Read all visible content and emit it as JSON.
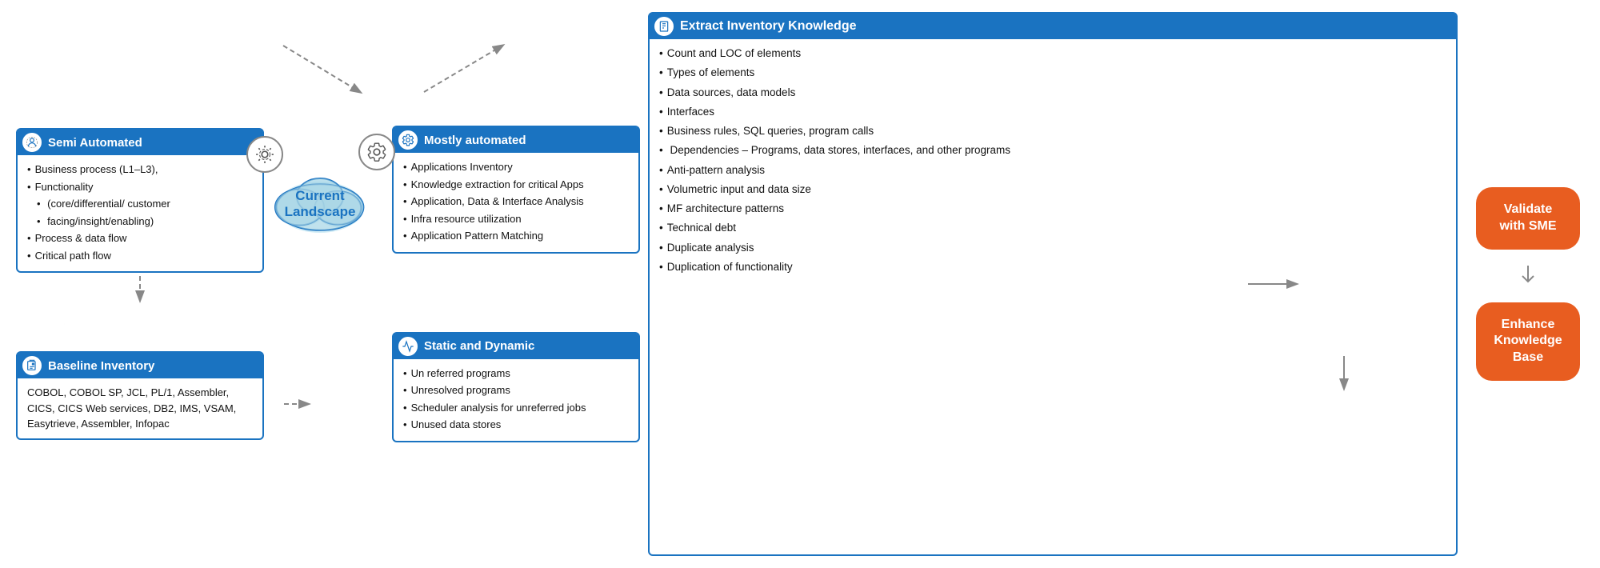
{
  "boxes": {
    "semi_automated": {
      "title": "Semi Automated",
      "items": [
        "Business process (L1–L3),",
        "Functionality",
        " (core/differential/ customer",
        " facing/insight/enabling)",
        "Process & data flow",
        "Critical path  flow"
      ]
    },
    "baseline_inventory": {
      "title": "Baseline Inventory",
      "body": "COBOL, COBOL SP, JCL, PL/1, Assembler, CICS, CICS Web services,  DB2, IMS, VSAM, Easytrieve, Assembler, Infopac"
    },
    "mostly_automated": {
      "title": "Mostly automated",
      "items": [
        "Applications Inventory",
        "Knowledge extraction for critical Apps",
        "Application, Data & Interface Analysis",
        "Infra resource utilization",
        "Application Pattern Matching"
      ]
    },
    "static_dynamic": {
      "title": "Static and Dynamic",
      "items": [
        "Un referred programs",
        "Unresolved programs",
        "Scheduler analysis for  unreferred jobs",
        "Unused data stores"
      ]
    },
    "extract_inventory": {
      "title": "Extract Inventory Knowledge",
      "items": [
        "Count and LOC of elements",
        "Types of elements",
        "Data sources, data models",
        "Interfaces",
        "Business rules, SQL queries, program calls",
        " Dependencies – Programs, data stores, interfaces, and other programs",
        "Anti-pattern analysis",
        "Volumetric input and data size",
        "MF architecture patterns",
        "Technical debt",
        "Duplicate analysis",
        "Duplication of functionality"
      ]
    }
  },
  "cloud": {
    "line1": "Current",
    "line2": "Landscape"
  },
  "buttons": {
    "validate": "Validate\nwith SME",
    "enhance": "Enhance\nKnowledge\nBase"
  }
}
